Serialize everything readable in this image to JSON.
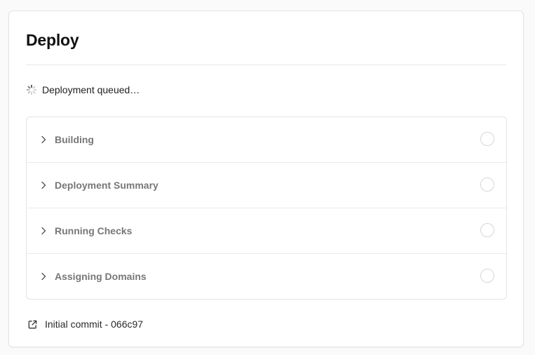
{
  "title": "Deploy",
  "status": {
    "icon": "spinner-icon",
    "text": "Deployment queued…"
  },
  "steps": [
    {
      "label": "Building",
      "icon": "chevron-right-icon",
      "state": "pending"
    },
    {
      "label": "Deployment Summary",
      "icon": "chevron-right-icon",
      "state": "pending"
    },
    {
      "label": "Running Checks",
      "icon": "chevron-right-icon",
      "state": "pending"
    },
    {
      "label": "Assigning Domains",
      "icon": "chevron-right-icon",
      "state": "pending"
    }
  ],
  "commit": {
    "icon": "external-link-icon",
    "text": "Initial commit - 066c97"
  },
  "colors": {
    "title": "#111111",
    "step_label": "#777777",
    "border": "#e4e4e4",
    "background": "#fafafa"
  }
}
